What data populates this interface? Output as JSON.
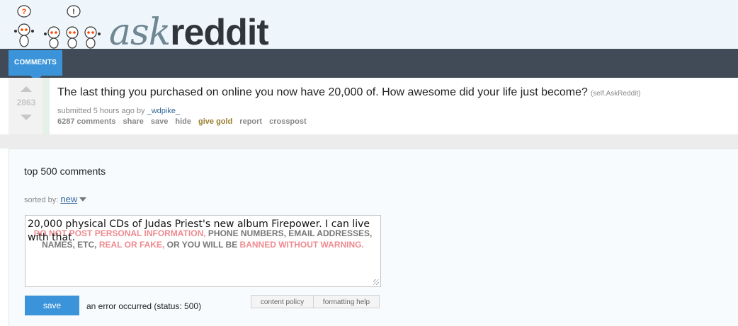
{
  "header": {
    "logo_ask": "ask",
    "logo_reddit": "reddit",
    "tab_label": "COMMENTS"
  },
  "post": {
    "score": "2863",
    "title": "The last thing you purchased on online you now have 20,000 of. How awesome did your life just become?",
    "domain": "(self.AskReddit)",
    "submitted_prefix": "submitted 5 hours ago by",
    "author": "_wdpike_",
    "buttons": [
      "6287 comments",
      "share",
      "save",
      "hide",
      "give gold",
      "report",
      "crosspost"
    ]
  },
  "comments": {
    "title": "top 500 comments",
    "sorted_label": "sorted by:",
    "sort_value": "new",
    "warning": {
      "part1": "DO NOT POST PERSONAL INFORMATION,",
      "part2": " PHONE NUMBERS, EMAIL ADDRESSES,",
      "part3": "NAMES, ETC,",
      "part4": "REAL OR FAKE,",
      "part5": " OR YOU WILL BE ",
      "part6": "BANNED WITHOUT WARNING."
    },
    "input_value": "20,000 physical CDs of Judas Priest's new album Firepower.  I can live with that.",
    "save_label": "save",
    "error_text": "an error occurred (status: 500)",
    "content_policy_label": "content policy",
    "formatting_help_label": "formatting help"
  },
  "colors": {
    "accent": "#3b94d9",
    "header_bar": "#414b57",
    "warning_red": "#ee8a8f",
    "gold": "#9a7d2e"
  }
}
